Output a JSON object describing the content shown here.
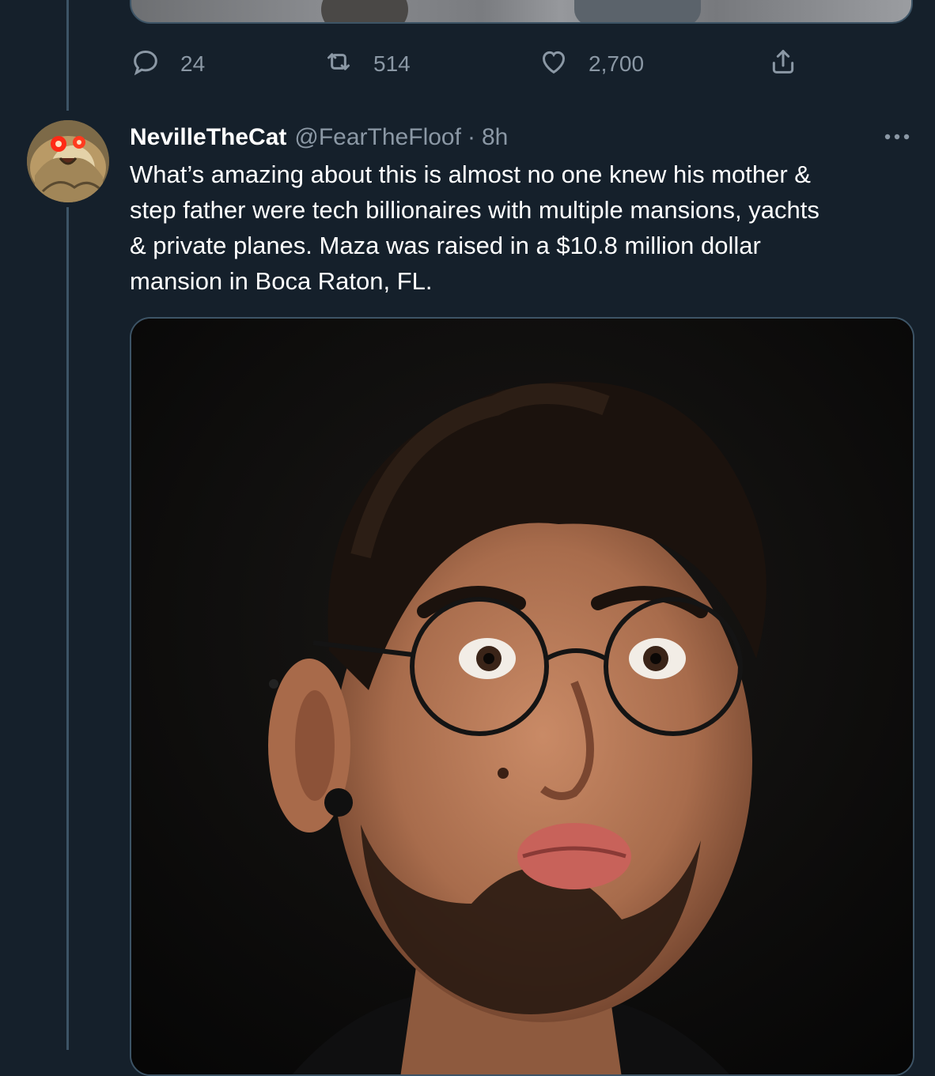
{
  "previous_tweet": {
    "actions": {
      "reply_count": "24",
      "retweet_count": "514",
      "like_count": "2,700"
    },
    "icons": {
      "reply": "reply-icon",
      "retweet": "retweet-icon",
      "like": "heart-icon",
      "share": "share-icon"
    }
  },
  "tweet": {
    "display_name": "NevilleTheCat",
    "handle": "@FearTheFloof",
    "separator": "·",
    "time": "8h",
    "text_lines": [
      "What’s amazing about this is almost no one knew his mother &",
      "step father were tech billionaires with multiple mansions, yachts",
      "& private planes. Maza was raised in a $10.8 million dollar",
      "mansion in Boca Raton, FL."
    ],
    "more_icon": "more-options-icon",
    "media_description_icon": "photo"
  },
  "colors": {
    "background": "#15202b",
    "secondary_text": "#8b98a5",
    "border": "#3d5466",
    "primary_text": "#ffffff"
  }
}
